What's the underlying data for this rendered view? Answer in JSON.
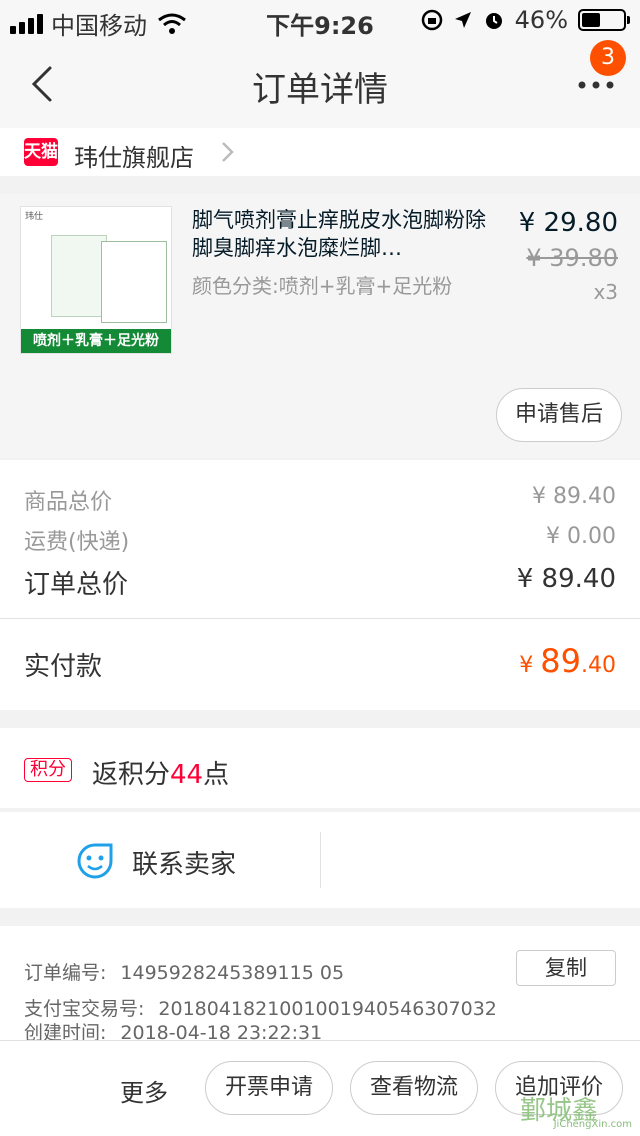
{
  "status_bar": {
    "carrier": "中国移动",
    "time": "下午9:26",
    "battery": "46%",
    "battery_level": 0.46
  },
  "nav": {
    "title": "订单详情",
    "badge": "3"
  },
  "store": {
    "logo_text": "天猫",
    "name": "玮仕旗舰店"
  },
  "item": {
    "title": "脚气喷剂膏止痒脱皮水泡脚粉除脚臭脚痒水泡糜烂脚…",
    "sku": "颜色分类:喷剂+乳膏+足光粉",
    "price": "¥ 29.80",
    "original_price": "¥ 39.80",
    "quantity": "x3",
    "image_band_text": "喷剂＋乳膏＋足光粉",
    "image_brand": "玮仕",
    "after_sale_button": "申请售后"
  },
  "summary": {
    "goods_total_label": "商品总价",
    "goods_total": "¥ 89.40",
    "shipping_label": "运费(快递)",
    "shipping": "¥ 0.00",
    "order_total_label": "订单总价",
    "order_total": "¥ 89.40",
    "paid_label": "实付款",
    "paid_prefix": "¥ ",
    "paid_int": "89",
    "paid_dec": ".40"
  },
  "points": {
    "tag": "积分",
    "text_before": "返积分",
    "amount": "44",
    "text_after": "点"
  },
  "contact": {
    "label": "联系卖家"
  },
  "order_info": {
    "order_no_label": "订单编号:",
    "order_no": "1495928245389115 05",
    "alipay_label": "支付宝交易号:",
    "alipay_no": "2018041821001001940546307032",
    "created_label": "创建时间:",
    "created": "2018-04-18 23:22:31",
    "copy_button": "复制"
  },
  "bottom_bar": {
    "more": "更多",
    "invoice": "开票申请",
    "logistics": "查看物流",
    "review": "追加评价"
  },
  "watermark": {
    "text": "JiChengXin.com",
    "big": "鄞城鑫"
  },
  "colors": {
    "accent": "#ff5000",
    "tmall_red": "#ff0036",
    "page_bg": "#f2f2f2"
  }
}
